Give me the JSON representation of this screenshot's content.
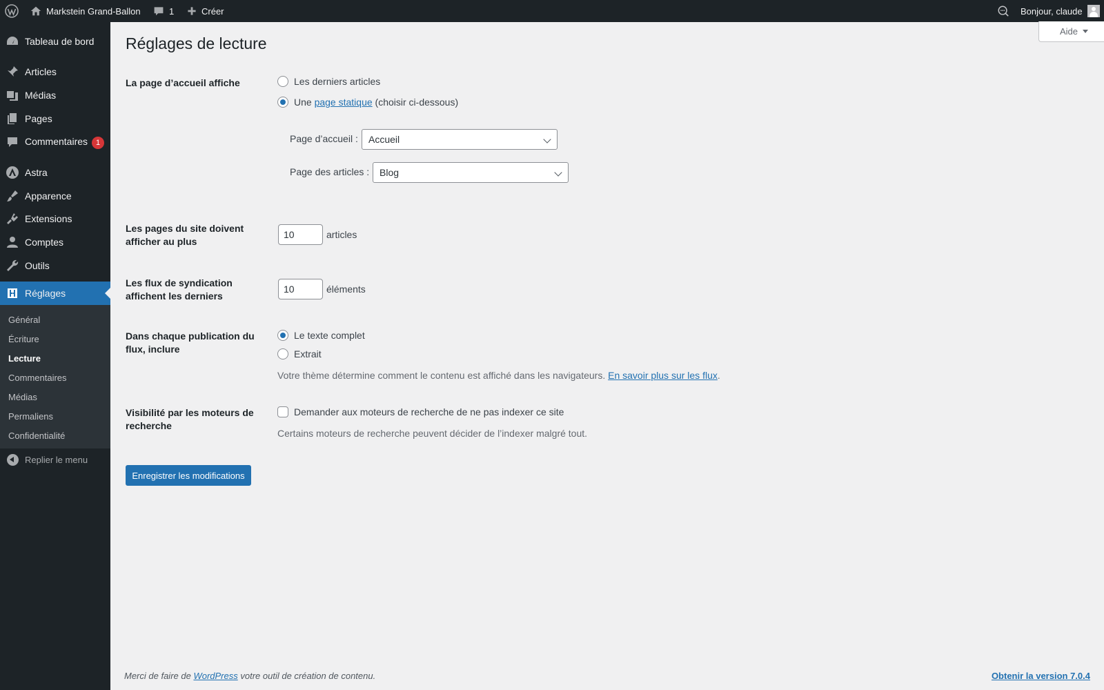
{
  "adminbar": {
    "site_name": "Markstein Grand-Ballon",
    "comments_count": "1",
    "create_label": "Créer",
    "greeting": "Bonjour, claude"
  },
  "sidebar": {
    "items": [
      {
        "label": "Tableau de bord",
        "icon": "dashboard-icon"
      },
      {
        "label": "Articles",
        "icon": "pin-icon"
      },
      {
        "label": "Médias",
        "icon": "media-icon"
      },
      {
        "label": "Pages",
        "icon": "pages-icon"
      },
      {
        "label": "Commentaires",
        "icon": "comment-icon",
        "badge": "1"
      },
      {
        "label": "Astra",
        "icon": "astra-icon"
      },
      {
        "label": "Apparence",
        "icon": "brush-icon"
      },
      {
        "label": "Extensions",
        "icon": "plugin-icon"
      },
      {
        "label": "Comptes",
        "icon": "user-icon"
      },
      {
        "label": "Outils",
        "icon": "wrench-icon"
      },
      {
        "label": "Réglages",
        "icon": "settings-icon",
        "current": true
      }
    ],
    "submenu": [
      "Général",
      "Écriture",
      "Lecture",
      "Commentaires",
      "Médias",
      "Permaliens",
      "Confidentialité"
    ],
    "submenu_current": "Lecture",
    "collapse_label": "Replier le menu"
  },
  "help_label": "Aide",
  "page_title": "Réglages de lecture",
  "front_page": {
    "label": "La page d’accueil affiche",
    "option_latest": "Les derniers articles",
    "option_static_prefix": "Une",
    "option_static_link": "page statique",
    "option_static_suffix": "(choisir ci-dessous)",
    "selected": "static",
    "homepage_label": "Page d’accueil :",
    "homepage_value": "Accueil",
    "posts_page_label": "Page des articles :",
    "posts_page_value": "Blog"
  },
  "posts_per_page": {
    "label_line1": "Les pages du site doivent",
    "label_line2": "afficher au plus",
    "value": "10",
    "unit": "articles"
  },
  "feed_items": {
    "label_line1": "Les flux de syndication",
    "label_line2": "affichent les derniers",
    "value": "10",
    "unit": "éléments"
  },
  "feed_content": {
    "label_line1": "Dans chaque publication du",
    "label_line2": "flux, inclure",
    "option_full": "Le texte complet",
    "option_excerpt": "Extrait",
    "selected": "full",
    "desc_text": "Votre thème détermine comment le contenu est affiché dans les navigateurs.",
    "desc_link": "En savoir plus sur les flux",
    "desc_end": "."
  },
  "search_visibility": {
    "label_line1": "Visibilité par les moteurs de",
    "label_line2": "recherche",
    "checkbox_label": "Demander aux moteurs de recherche de ne pas indexer ce site",
    "checked": false,
    "desc": "Certains moteurs de recherche peuvent décider de l’indexer malgré tout."
  },
  "save_label": "Enregistrer les modifications",
  "footer": {
    "prefix": "Merci de faire de",
    "link": "WordPress",
    "suffix": "votre outil de création de contenu.",
    "version_link": "Obtenir la version 7.0.4"
  },
  "colors": {
    "admin_dark": "#1d2327",
    "accent_blue": "#2271b1",
    "badge_red": "#d63638",
    "background": "#f0f0f1"
  }
}
